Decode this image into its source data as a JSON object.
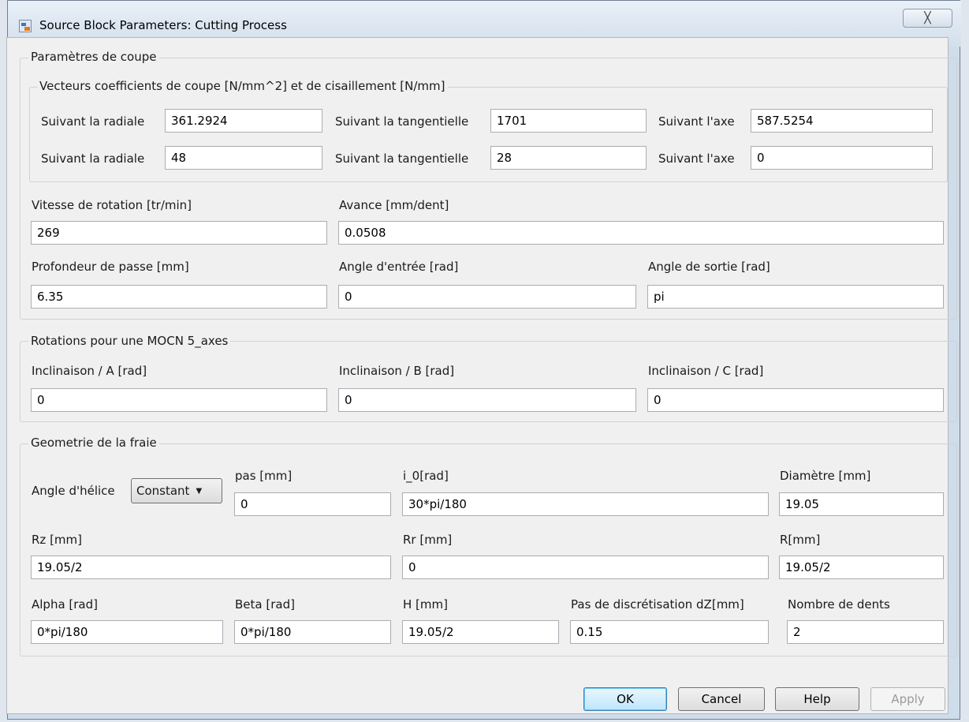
{
  "window": {
    "title": "Source Block Parameters: Cutting Process",
    "close_symbol": "╳"
  },
  "groups": {
    "cutting": "Paramètres de coupe",
    "coefficients": "Vecteurs coefficients de coupe [N/mm^2] et de cisaillement [N/mm]",
    "rotations": "Rotations pour une MOCN 5_axes",
    "geometry": "Geometrie de la fraie"
  },
  "coefficients": {
    "row1": {
      "radial_label": "Suivant la radiale",
      "radial_value": "361.2924",
      "tangential_label": "Suivant la tangentielle",
      "tangential_value": "1701",
      "axial_label": "Suivant l'axe",
      "axial_value": "587.5254"
    },
    "row2": {
      "radial_label": "Suivant la radiale",
      "radial_value": "48",
      "tangential_label": "Suivant la tangentielle",
      "tangential_value": "28",
      "axial_label": "Suivant l'axe",
      "axial_value": "0"
    }
  },
  "cutting": {
    "speed_label": "Vitesse de rotation [tr/min]",
    "speed_value": "269",
    "feed_label": "Avance [mm/dent]",
    "feed_value": "0.0508",
    "depth_label": "Profondeur de passe [mm]",
    "depth_value": "6.35",
    "entry_label": "Angle d'entrée [rad]",
    "entry_value": "0",
    "exit_label": "Angle de sortie [rad]",
    "exit_value": "pi"
  },
  "rotations": {
    "a_label": "Inclinaison / A [rad]",
    "a_value": "0",
    "b_label": "Inclinaison / B [rad]",
    "b_value": "0",
    "c_label": "Inclinaison / C [rad]",
    "c_value": "0"
  },
  "geometry": {
    "helix_label": "Angle d'hélice",
    "helix_selected": "Constant",
    "pas_label": "pas [mm]",
    "pas_value": "0",
    "i0_label": "i_0[rad]",
    "i0_value": "30*pi/180",
    "diam_label": "Diamètre [mm]",
    "diam_value": "19.05",
    "rz_label": "Rz [mm]",
    "rz_value": "19.05/2",
    "rr_label": "Rr [mm]",
    "rr_value": "0",
    "r_label": "R[mm]",
    "r_value": "19.05/2",
    "alpha_label": "Alpha [rad]",
    "alpha_value": "0*pi/180",
    "beta_label": "Beta [rad]",
    "beta_value": "0*pi/180",
    "h_label": "H [mm]",
    "h_value": "19.05/2",
    "dz_label": "Pas de discrétisation dZ[mm]",
    "dz_value": "0.15",
    "teeth_label": "Nombre de dents",
    "teeth_value": "2"
  },
  "buttons": {
    "ok": "OK",
    "cancel": "Cancel",
    "help": "Help",
    "apply": "Apply"
  }
}
